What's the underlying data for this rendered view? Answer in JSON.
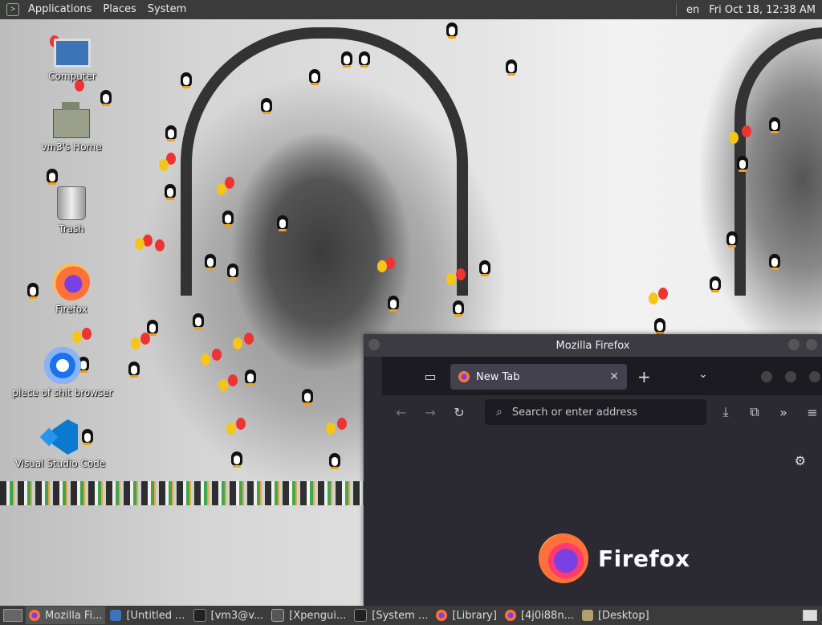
{
  "top_panel": {
    "menus": [
      "Applications",
      "Places",
      "System"
    ],
    "language": "en",
    "clock": "Fri Oct 18, 12:38 AM"
  },
  "desktop_icons": [
    {
      "label": "Computer",
      "icon": "computer-icon"
    },
    {
      "label": "vm3's Home",
      "icon": "home-folder-icon"
    },
    {
      "label": "Trash",
      "icon": "trash-icon"
    },
    {
      "label": "Firefox",
      "icon": "firefox-icon"
    },
    {
      "label": "piece of shit browser",
      "icon": "chrome-icon"
    },
    {
      "label": "Visual Studio Code",
      "icon": "vscode-icon"
    }
  ],
  "firefox_window": {
    "title": "Mozilla Firefox",
    "tab_title": "New Tab",
    "url_placeholder": "Search or enter address",
    "brand": "Firefox"
  },
  "taskbar": {
    "items": [
      {
        "label": "Mozilla Fi...",
        "icon": "firefox-icon",
        "active": true
      },
      {
        "label": "[Untitled ...",
        "icon": "document-icon",
        "active": false
      },
      {
        "label": "[vm3@v...",
        "icon": "terminal-icon",
        "active": false
      },
      {
        "label": "[Xpengui...",
        "icon": "window-icon",
        "active": false
      },
      {
        "label": "[System ...",
        "icon": "monitor-icon",
        "active": false
      },
      {
        "label": "[Library]",
        "icon": "firefox-icon",
        "active": false
      },
      {
        "label": "[4j0i88n...",
        "icon": "firefox-icon",
        "active": false
      },
      {
        "label": "[Desktop]",
        "icon": "folder-icon",
        "active": false
      }
    ]
  },
  "colors": {
    "panel": "#3b3b3b",
    "firefox_chrome": "#2b2a33",
    "tab_active": "#42414d"
  }
}
